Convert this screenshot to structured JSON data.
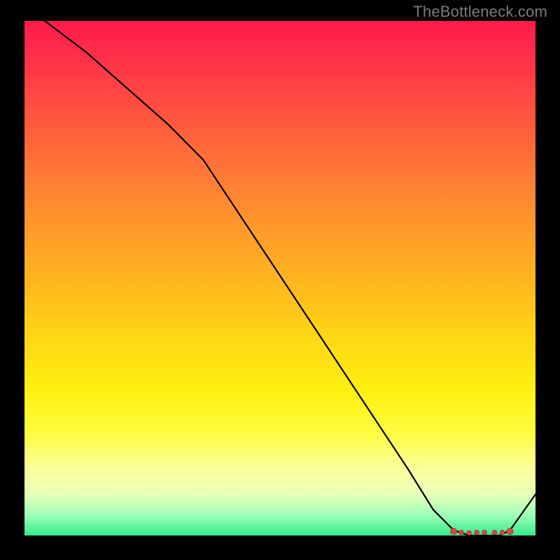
{
  "watermark": "TheBottleneck.com",
  "chart_data": {
    "type": "line",
    "title": "",
    "xlabel": "",
    "ylabel": "",
    "xlim": [
      0,
      100
    ],
    "ylim": [
      0,
      100
    ],
    "series": [
      {
        "name": "curve",
        "x": [
          0,
          12,
          28,
          35,
          45,
          55,
          65,
          75,
          80,
          84,
          87,
          90,
          93,
          95,
          100
        ],
        "values": [
          103,
          94,
          80,
          73,
          58,
          43,
          28,
          13,
          5,
          1,
          0,
          0,
          0,
          1,
          8
        ]
      }
    ],
    "markers": {
      "x": [
        84,
        85.5,
        87,
        88.5,
        90,
        92,
        93.5,
        95
      ],
      "values": [
        0.8,
        0.6,
        0.5,
        0.6,
        0.6,
        0.6,
        0.6,
        0.8
      ]
    },
    "background_gradient": {
      "top": "#ff1a4b",
      "bottom": "#35e98c"
    }
  }
}
